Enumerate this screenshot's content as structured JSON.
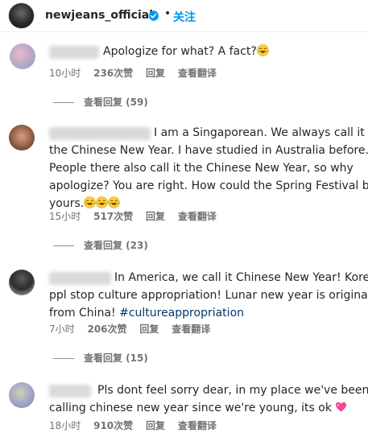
{
  "header": {
    "username": "newjeans_official",
    "separator": "•",
    "follow_label": "关注"
  },
  "comments": [
    {
      "text_before": "Apologize for what?  A fact?",
      "meta": {
        "time": "10小时",
        "likes": "236次赞",
        "reply": "回复",
        "translate": "查看翻译"
      },
      "replies_label": "查看回复 (59)"
    },
    {
      "lines": [
        "I am a Singaporean. We always call it",
        "the Chinese New Year. I have studied in Australia before.",
        "People there also call it the Chinese New Year, so why",
        "apologize? You are right. How could the Spring Festival be",
        "yours."
      ],
      "meta": {
        "time": "15小时",
        "likes": "517次赞",
        "reply": "回复",
        "translate": "查看翻译"
      },
      "replies_label": "查看回复 (23)"
    },
    {
      "lines": [
        "In America, we call it Chinese New Year! Korean",
        "ppl stop culture appropriation! Lunar new year is originally",
        "from China! "
      ],
      "hashtag": "#cultureappropriation",
      "meta": {
        "time": "7小时",
        "likes": "206次赞",
        "reply": "回复",
        "translate": "查看翻译"
      },
      "replies_label": "查看回复 (15)"
    },
    {
      "lines": [
        "Pls dont feel sorry dear, in my place we've been",
        "calling chinese new year since we're young, its ok"
      ],
      "meta": {
        "time": "18小时",
        "likes": "910次赞",
        "reply": "回复",
        "translate": "查看翻译"
      }
    }
  ],
  "icons": {
    "verified": "verified-badge-icon",
    "laugh": "face-with-tears-of-joy-emoji",
    "heart": "sparkling-heart-emoji"
  },
  "colors": {
    "accent": "#0095f6",
    "hashtag": "#00376b",
    "meta": "#737373"
  }
}
